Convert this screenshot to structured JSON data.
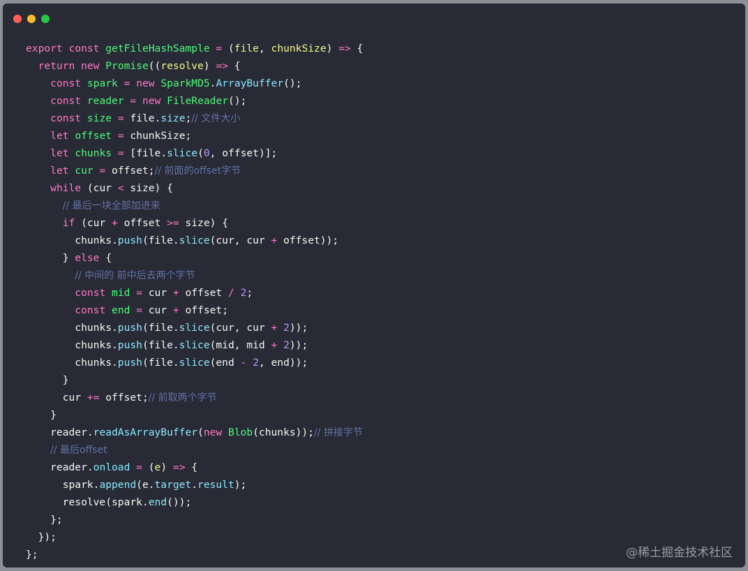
{
  "colors": {
    "background": "#282a36",
    "frame": "#8e9098",
    "dot_red": "#ff5f56",
    "dot_yellow": "#ffbd2e",
    "dot_green": "#27c93f"
  },
  "code_lines": [
    [
      [
        "kw",
        "export"
      ],
      [
        "plain",
        " "
      ],
      [
        "kw",
        "const"
      ],
      [
        "plain",
        " "
      ],
      [
        "fn",
        "getFileHashSample"
      ],
      [
        "plain",
        " "
      ],
      [
        "op",
        "="
      ],
      [
        "plain",
        " ("
      ],
      [
        "param",
        "file"
      ],
      [
        "plain",
        ", "
      ],
      [
        "param",
        "chunkSize"
      ],
      [
        "plain",
        ") "
      ],
      [
        "op",
        "=>"
      ],
      [
        "plain",
        " {"
      ]
    ],
    [
      [
        "plain",
        "  "
      ],
      [
        "kw",
        "return"
      ],
      [
        "plain",
        " "
      ],
      [
        "kw",
        "new"
      ],
      [
        "plain",
        " "
      ],
      [
        "cls",
        "Promise"
      ],
      [
        "plain",
        "(("
      ],
      [
        "param",
        "resolve"
      ],
      [
        "plain",
        ") "
      ],
      [
        "op",
        "=>"
      ],
      [
        "plain",
        " {"
      ]
    ],
    [
      [
        "plain",
        "    "
      ],
      [
        "kw",
        "const"
      ],
      [
        "plain",
        " "
      ],
      [
        "var",
        "spark"
      ],
      [
        "plain",
        " "
      ],
      [
        "op",
        "="
      ],
      [
        "plain",
        " "
      ],
      [
        "kw",
        "new"
      ],
      [
        "plain",
        " "
      ],
      [
        "cls",
        "SparkMD5"
      ],
      [
        "plain",
        "."
      ],
      [
        "prop",
        "ArrayBuffer"
      ],
      [
        "plain",
        "();"
      ]
    ],
    [
      [
        "plain",
        "    "
      ],
      [
        "kw",
        "const"
      ],
      [
        "plain",
        " "
      ],
      [
        "var",
        "reader"
      ],
      [
        "plain",
        " "
      ],
      [
        "op",
        "="
      ],
      [
        "plain",
        " "
      ],
      [
        "kw",
        "new"
      ],
      [
        "plain",
        " "
      ],
      [
        "cls",
        "FileReader"
      ],
      [
        "plain",
        "();"
      ]
    ],
    [
      [
        "plain",
        "    "
      ],
      [
        "kw",
        "const"
      ],
      [
        "plain",
        " "
      ],
      [
        "var",
        "size"
      ],
      [
        "plain",
        " "
      ],
      [
        "op",
        "="
      ],
      [
        "plain",
        " file."
      ],
      [
        "prop",
        "size"
      ],
      [
        "plain",
        ";"
      ],
      [
        "comment",
        "// 文件大小"
      ]
    ],
    [
      [
        "plain",
        "    "
      ],
      [
        "kw",
        "let"
      ],
      [
        "plain",
        " "
      ],
      [
        "var",
        "offset"
      ],
      [
        "plain",
        " "
      ],
      [
        "op",
        "="
      ],
      [
        "plain",
        " chunkSize;"
      ]
    ],
    [
      [
        "plain",
        "    "
      ],
      [
        "kw",
        "let"
      ],
      [
        "plain",
        " "
      ],
      [
        "var",
        "chunks"
      ],
      [
        "plain",
        " "
      ],
      [
        "op",
        "="
      ],
      [
        "plain",
        " [file."
      ],
      [
        "method",
        "slice"
      ],
      [
        "plain",
        "("
      ],
      [
        "num",
        "0"
      ],
      [
        "plain",
        ", offset)];"
      ]
    ],
    [
      [
        "plain",
        "    "
      ],
      [
        "kw",
        "let"
      ],
      [
        "plain",
        " "
      ],
      [
        "var",
        "cur"
      ],
      [
        "plain",
        " "
      ],
      [
        "op",
        "="
      ],
      [
        "plain",
        " offset;"
      ],
      [
        "comment",
        "// 前面的offset字节"
      ]
    ],
    [
      [
        "plain",
        "    "
      ],
      [
        "kw",
        "while"
      ],
      [
        "plain",
        " (cur "
      ],
      [
        "op",
        "<"
      ],
      [
        "plain",
        " size) {"
      ]
    ],
    [
      [
        "plain",
        "      "
      ],
      [
        "comment",
        "// 最后一块全部加进来"
      ]
    ],
    [
      [
        "plain",
        "      "
      ],
      [
        "kw",
        "if"
      ],
      [
        "plain",
        " (cur "
      ],
      [
        "op",
        "+"
      ],
      [
        "plain",
        " offset "
      ],
      [
        "op",
        ">="
      ],
      [
        "plain",
        " size) {"
      ]
    ],
    [
      [
        "plain",
        "        chunks."
      ],
      [
        "method",
        "push"
      ],
      [
        "plain",
        "(file."
      ],
      [
        "method",
        "slice"
      ],
      [
        "plain",
        "(cur, cur "
      ],
      [
        "op",
        "+"
      ],
      [
        "plain",
        " offset));"
      ]
    ],
    [
      [
        "plain",
        "      } "
      ],
      [
        "kw",
        "else"
      ],
      [
        "plain",
        " {"
      ]
    ],
    [
      [
        "plain",
        "        "
      ],
      [
        "comment",
        "// 中间的 前中后去两个字节"
      ]
    ],
    [
      [
        "plain",
        "        "
      ],
      [
        "kw",
        "const"
      ],
      [
        "plain",
        " "
      ],
      [
        "var",
        "mid"
      ],
      [
        "plain",
        " "
      ],
      [
        "op",
        "="
      ],
      [
        "plain",
        " cur "
      ],
      [
        "op",
        "+"
      ],
      [
        "plain",
        " offset "
      ],
      [
        "op",
        "/"
      ],
      [
        "plain",
        " "
      ],
      [
        "num",
        "2"
      ],
      [
        "plain",
        ";"
      ]
    ],
    [
      [
        "plain",
        "        "
      ],
      [
        "kw",
        "const"
      ],
      [
        "plain",
        " "
      ],
      [
        "var",
        "end"
      ],
      [
        "plain",
        " "
      ],
      [
        "op",
        "="
      ],
      [
        "plain",
        " cur "
      ],
      [
        "op",
        "+"
      ],
      [
        "plain",
        " offset;"
      ]
    ],
    [
      [
        "plain",
        "        chunks."
      ],
      [
        "method",
        "push"
      ],
      [
        "plain",
        "(file."
      ],
      [
        "method",
        "slice"
      ],
      [
        "plain",
        "(cur, cur "
      ],
      [
        "op",
        "+"
      ],
      [
        "plain",
        " "
      ],
      [
        "num",
        "2"
      ],
      [
        "plain",
        "));"
      ]
    ],
    [
      [
        "plain",
        "        chunks."
      ],
      [
        "method",
        "push"
      ],
      [
        "plain",
        "(file."
      ],
      [
        "method",
        "slice"
      ],
      [
        "plain",
        "(mid, mid "
      ],
      [
        "op",
        "+"
      ],
      [
        "plain",
        " "
      ],
      [
        "num",
        "2"
      ],
      [
        "plain",
        "));"
      ]
    ],
    [
      [
        "plain",
        "        chunks."
      ],
      [
        "method",
        "push"
      ],
      [
        "plain",
        "(file."
      ],
      [
        "method",
        "slice"
      ],
      [
        "plain",
        "(end "
      ],
      [
        "op",
        "-"
      ],
      [
        "plain",
        " "
      ],
      [
        "num",
        "2"
      ],
      [
        "plain",
        ", end));"
      ]
    ],
    [
      [
        "plain",
        "      }"
      ]
    ],
    [
      [
        "plain",
        "      cur "
      ],
      [
        "op",
        "+="
      ],
      [
        "plain",
        " offset;"
      ],
      [
        "comment",
        "// 前取两个字节"
      ]
    ],
    [
      [
        "plain",
        "    }"
      ]
    ],
    [
      [
        "plain",
        "    reader."
      ],
      [
        "method",
        "readAsArrayBuffer"
      ],
      [
        "plain",
        "("
      ],
      [
        "kw",
        "new"
      ],
      [
        "plain",
        " "
      ],
      [
        "cls",
        "Blob"
      ],
      [
        "plain",
        "(chunks));"
      ],
      [
        "comment",
        "// 拼接字节"
      ]
    ],
    [
      [
        "plain",
        "    "
      ],
      [
        "comment",
        "// 最后offset"
      ]
    ],
    [
      [
        "plain",
        "    reader."
      ],
      [
        "prop",
        "onload"
      ],
      [
        "plain",
        " "
      ],
      [
        "op",
        "="
      ],
      [
        "plain",
        " ("
      ],
      [
        "param",
        "e"
      ],
      [
        "plain",
        ") "
      ],
      [
        "op",
        "=>"
      ],
      [
        "plain",
        " {"
      ]
    ],
    [
      [
        "plain",
        "      spark."
      ],
      [
        "method",
        "append"
      ],
      [
        "plain",
        "(e."
      ],
      [
        "prop",
        "target"
      ],
      [
        "plain",
        "."
      ],
      [
        "prop",
        "result"
      ],
      [
        "plain",
        ");"
      ]
    ],
    [
      [
        "plain",
        "      resolve(spark."
      ],
      [
        "method",
        "end"
      ],
      [
        "plain",
        "());"
      ]
    ],
    [
      [
        "plain",
        "    };"
      ]
    ],
    [
      [
        "plain",
        "  });"
      ]
    ],
    [
      [
        "plain",
        "};"
      ]
    ]
  ],
  "watermark": "@稀土掘金技术社区"
}
